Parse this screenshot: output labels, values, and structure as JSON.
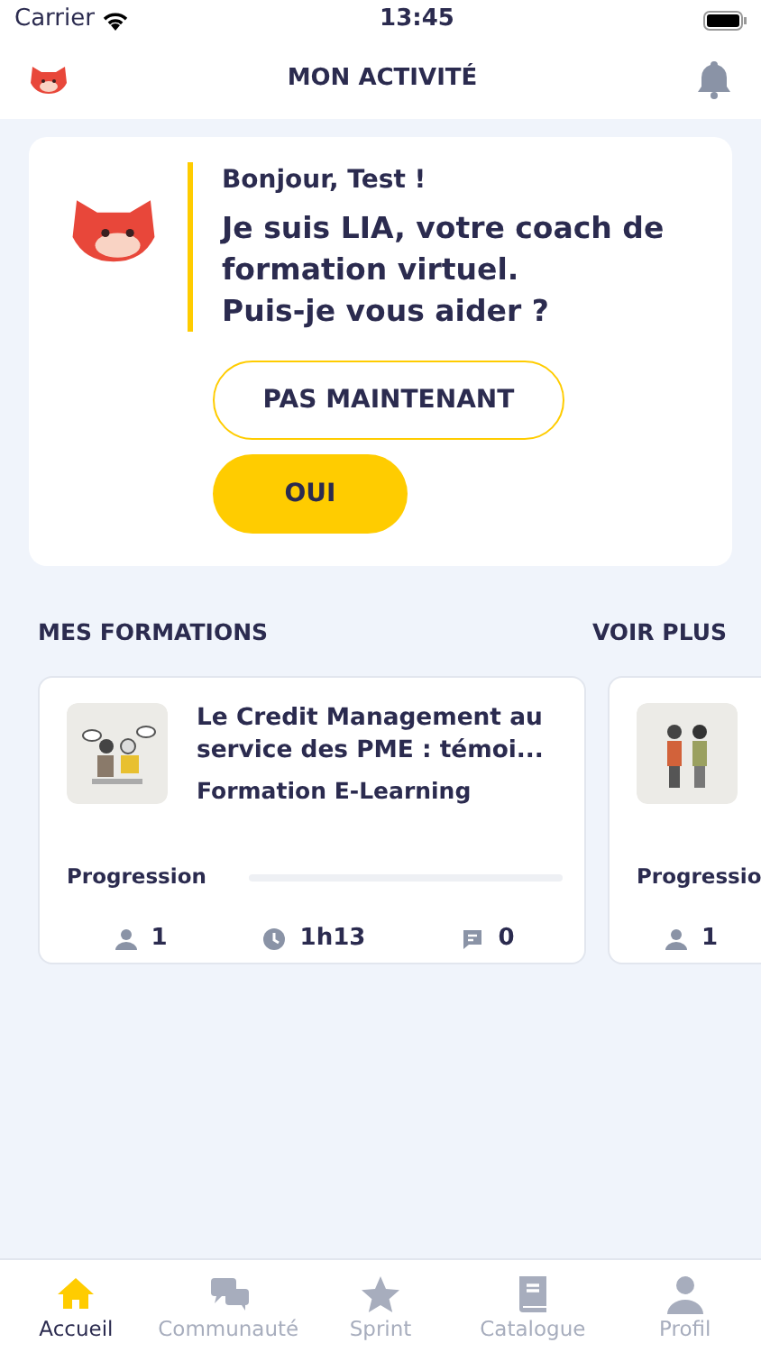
{
  "status_bar": {
    "carrier": "Carrier",
    "time": "13:45"
  },
  "header": {
    "title": "MON ACTIVITÉ"
  },
  "coach": {
    "greeting": "Bonjour, Test !",
    "message": "Je suis LIA, votre coach de formation virtuel.\nPuis-je vous aider ?",
    "buttons": [
      {
        "label": "PAS MAINTENANT",
        "kind": "outline"
      },
      {
        "label": "OUI",
        "kind": "filled"
      }
    ]
  },
  "section": {
    "title": "MES FORMATIONS",
    "link": "VOIR PLUS"
  },
  "courses": [
    {
      "title": "Le Credit Management au service des PME : témoi...",
      "type": "Formation E-Learning",
      "progress_label": "Progression",
      "level": 0,
      "stats": [
        {
          "kind": "users",
          "value": "1"
        },
        {
          "kind": "time",
          "value": "1h13"
        },
        {
          "kind": "comments",
          "value": "0"
        }
      ]
    },
    {
      "progress_label": "Progressio",
      "stats": [
        {
          "kind": "users",
          "value": "1"
        }
      ]
    }
  ],
  "tabs": [
    {
      "label": "Accueil",
      "kind": "home",
      "selected": true
    },
    {
      "label": "Communauté",
      "kind": "chat",
      "selected": false
    },
    {
      "label": "Sprint",
      "kind": "star",
      "selected": false
    },
    {
      "label": "Catalogue",
      "kind": "book",
      "selected": false
    },
    {
      "label": "Profil",
      "kind": "person",
      "selected": false
    }
  ]
}
